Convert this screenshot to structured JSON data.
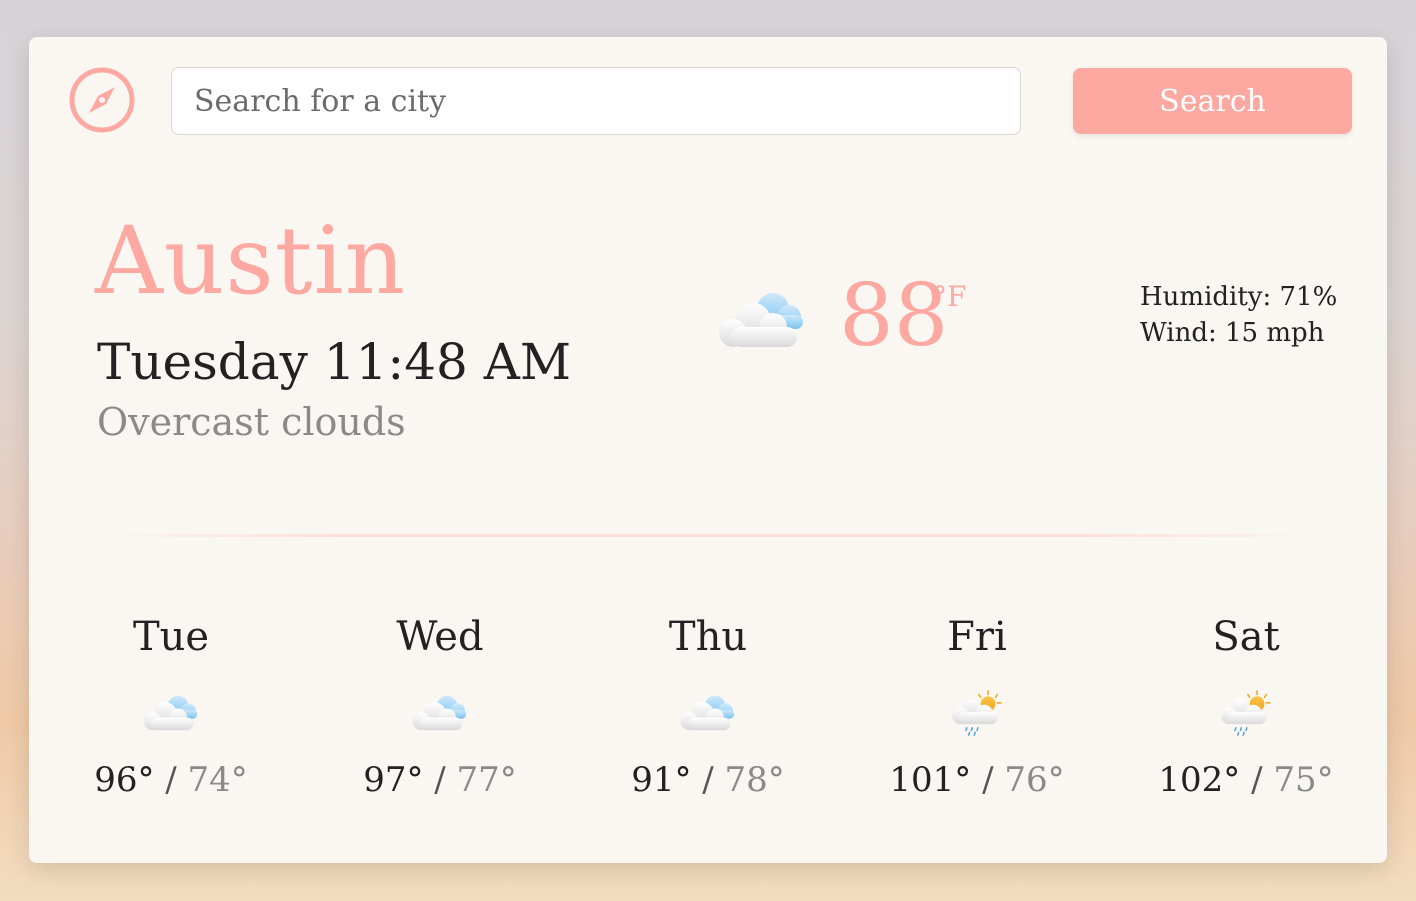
{
  "search": {
    "placeholder": "Search for a city",
    "button_label": "Search"
  },
  "icons": {
    "logo": "compass-icon",
    "current": "cloudy-icon"
  },
  "current": {
    "city": "Austin",
    "datetime": "Tuesday 11:48 AM",
    "description": "Overcast clouds",
    "temperature": "88",
    "unit": "°F",
    "humidity": "Humidity: 71%",
    "wind": "Wind: 15 mph"
  },
  "forecast": [
    {
      "day": "Tue",
      "icon": "cloudy-icon",
      "high": "96°",
      "low": "74°"
    },
    {
      "day": "Wed",
      "icon": "cloudy-icon",
      "high": "97°",
      "low": "77°"
    },
    {
      "day": "Thu",
      "icon": "cloudy-icon",
      "high": "91°",
      "low": "78°"
    },
    {
      "day": "Fri",
      "icon": "sun-rain-icon",
      "high": "101°",
      "low": "76°"
    },
    {
      "day": "Sat",
      "icon": "sun-rain-icon",
      "high": "102°",
      "low": "75°"
    }
  ],
  "colors": {
    "accent": "#fda9a2",
    "card_background": "#faf6f2",
    "text": "#222222",
    "muted": "#8a8a8a"
  }
}
